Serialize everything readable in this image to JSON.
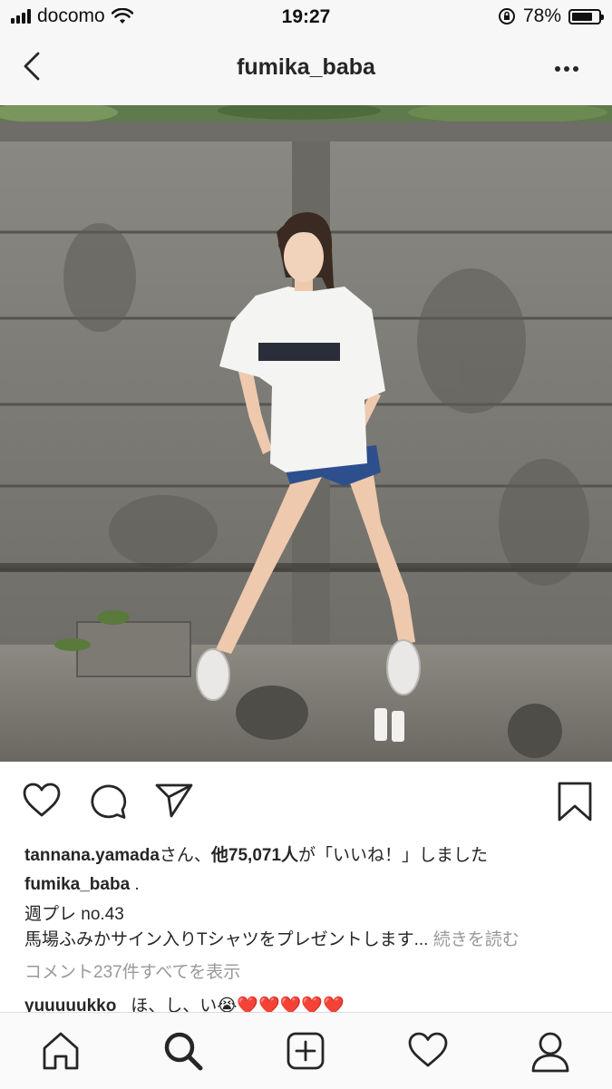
{
  "status_bar": {
    "carrier": "docomo",
    "time": "19:27",
    "battery": "78%",
    "battery_level": 0.78
  },
  "header": {
    "title": "fumika_baba",
    "back_icon": "chevron-left-icon",
    "more_icon": "more-horizontal-icon"
  },
  "post": {
    "image_name": "post-photo",
    "likes": {
      "user": "tannana.yamada",
      "mid": "さん、",
      "count_text": "他75,071人",
      "tail": "が「いいね！」しました"
    },
    "caption": {
      "username": "fumika_baba",
      "dot": " .",
      "line1": "週プレ no.43",
      "line2": "馬場ふみかサイン入りTシャツをプレゼントします...",
      "more": "続きを読む"
    },
    "view_comments": "コメント237件すべてを表示",
    "comment": {
      "username": "yuuuuukko_",
      "text": "ほ、し、い😭❤️❤️❤️❤️❤️"
    }
  },
  "actions": {
    "icons": [
      "heart-icon",
      "comment-icon",
      "share-icon",
      "bookmark-icon"
    ]
  },
  "tab_bar": {
    "icons": [
      "home-icon",
      "search-icon",
      "add-post-icon",
      "activity-heart-icon",
      "profile-icon"
    ]
  },
  "colors": {
    "text": "#262626",
    "muted": "#999999",
    "bar_bg": "#f7f7f7"
  }
}
